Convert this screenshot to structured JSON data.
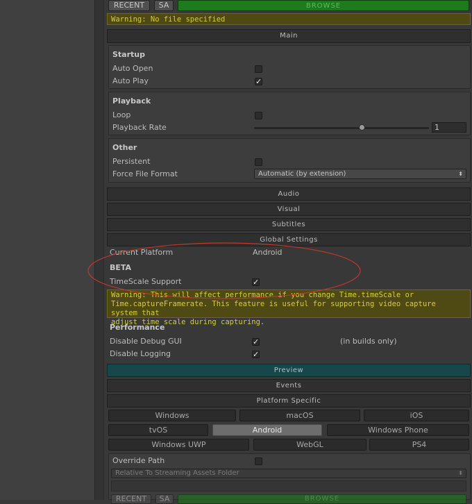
{
  "top_file": {
    "recent": "RECENT",
    "sa": "SA",
    "browse": "BROWSE",
    "warning": "Warning: No file specified"
  },
  "sections": {
    "main": "Main",
    "audio": "Audio",
    "visual": "Visual",
    "subtitles": "Subtitles",
    "global_settings": "Global Settings",
    "preview": "Preview",
    "events": "Events",
    "platform_specific": "Platform Specific"
  },
  "startup": {
    "title": "Startup",
    "auto_open": "Auto Open",
    "auto_open_checked": false,
    "auto_play": "Auto Play",
    "auto_play_checked": true
  },
  "playback": {
    "title": "Playback",
    "loop": "Loop",
    "loop_checked": false,
    "rate_label": "Playback Rate",
    "rate_value": "1",
    "rate_fraction": 0.62
  },
  "other": {
    "title": "Other",
    "persistent": "Persistent",
    "persistent_checked": false,
    "force_format": "Force File Format",
    "force_format_value": "Automatic (by extension)"
  },
  "global": {
    "current_platform_label": "Current Platform",
    "current_platform_value": "Android",
    "beta": "BETA",
    "timescale": "TimeScale Support",
    "timescale_checked": true,
    "warning_lines": [
      "Warning: This will affect performance if you change Time.timeScale or",
      "Time.captureFramerate.  This feature is useful for supporting video capture system that",
      "adjust time scale during capturing."
    ],
    "performance": "Performance",
    "disable_debug_gui": "Disable Debug GUI",
    "disable_debug_gui_checked": true,
    "builds_only": "(in builds only)",
    "disable_logging": "Disable Logging",
    "disable_logging_checked": true
  },
  "platforms": {
    "row1": [
      "Windows",
      "macOS",
      "iOS"
    ],
    "row2": [
      "tvOS",
      "Android",
      "Windows Phone"
    ],
    "row3": [
      "Windows UWP",
      "WebGL",
      "PS4"
    ],
    "active": "Android"
  },
  "override": {
    "label": "Override Path",
    "checked": false,
    "dropdown": "Relative To Streaming Assets Folder"
  },
  "bottom_file": {
    "recent": "RECENT",
    "sa": "SA",
    "browse": "BROWSE"
  },
  "colors": {
    "browse_green": "#1d7a1d",
    "warning_yellow": "#4f4a13",
    "preview_teal": "#16474a",
    "annotation_red": "#c0392b"
  }
}
